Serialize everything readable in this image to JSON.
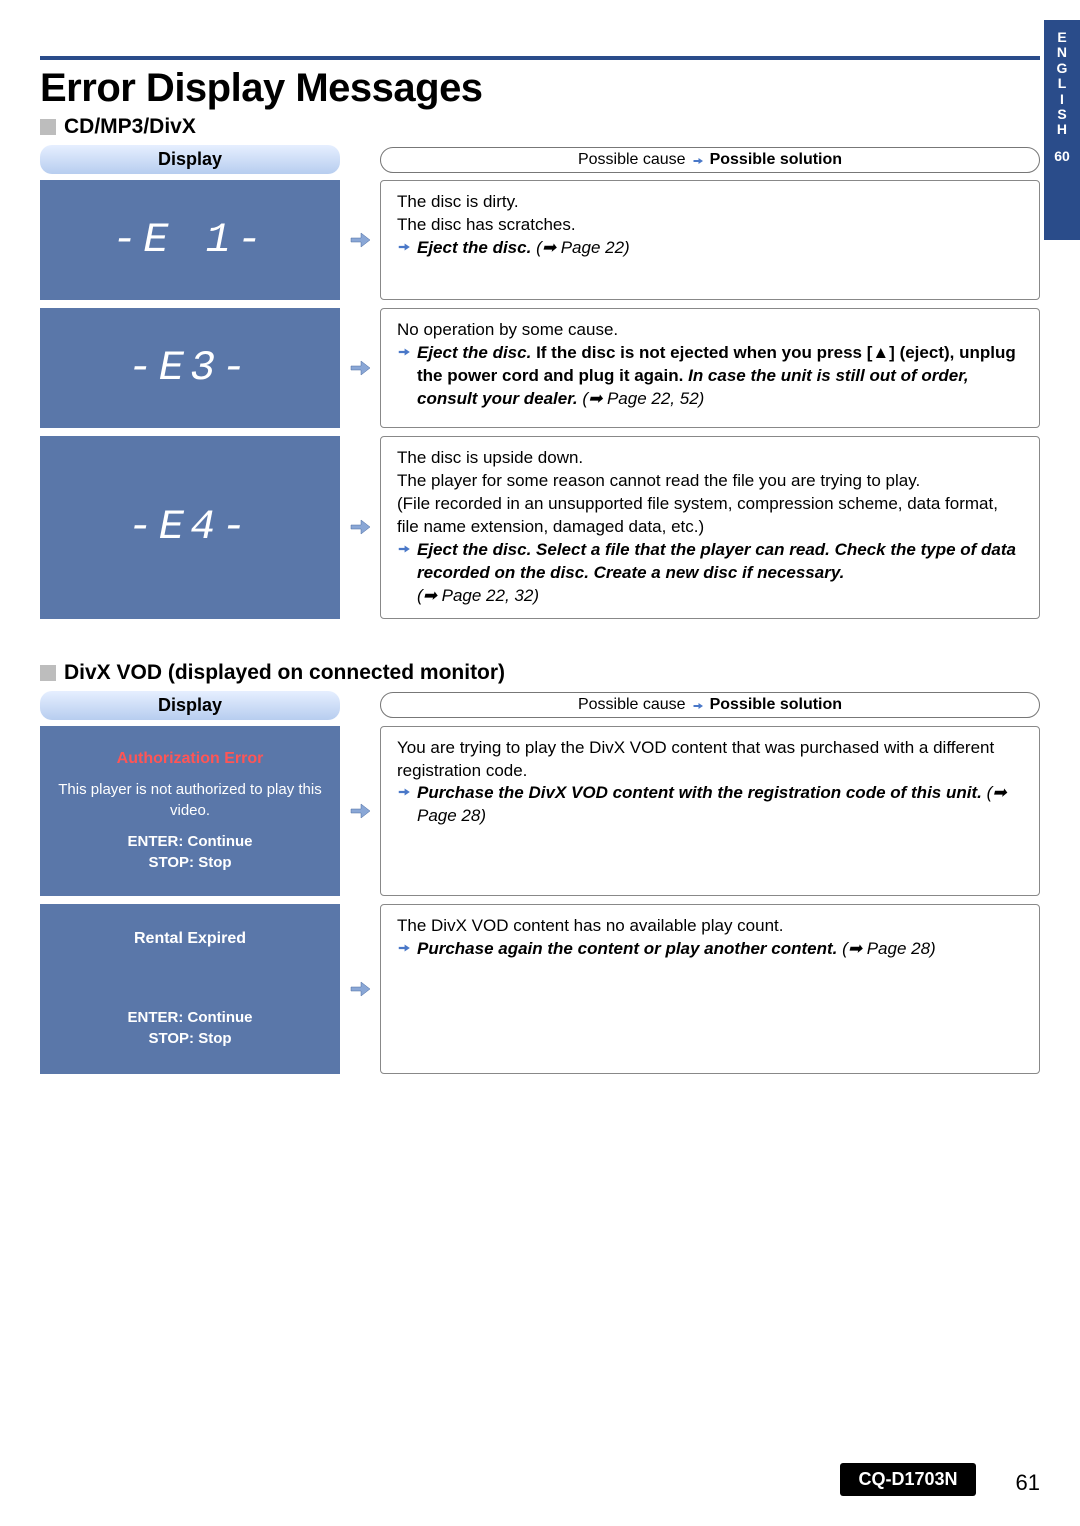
{
  "sideTab": {
    "letters": [
      "E",
      "N",
      "G",
      "L",
      "I",
      "S",
      "H"
    ],
    "num": "60"
  },
  "mainTitle": "Error Display Messages",
  "section1": {
    "heading": "CD/MP3/DivX",
    "displayHeader": "Display",
    "possibleCause": "Possible cause",
    "possibleSolution": "Possible solution",
    "rows": [
      {
        "code": "-E 1-",
        "cause": {
          "l1": "The disc is dirty.",
          "l2": "The disc has scratches.",
          "action": "Eject the disc.",
          "ref": "(➡ Page 22)"
        }
      },
      {
        "code": "-E3-",
        "cause": {
          "l1": "No operation by some cause.",
          "action1": "Eject the disc.",
          "bold1": "If the disc is not ejected when you press [▲] (eject), unplug the power cord and plug it again.",
          "italic1": "In case the unit is still out of order, consult your dealer.",
          "ref": "(➡ Page 22, 52)"
        }
      },
      {
        "code": "-E4-",
        "cause": {
          "l1": "The disc is upside down.",
          "l2": "The player for some reason cannot read the file you are trying to play.",
          "l3": "(File recorded in an unsupported file system, compression scheme, data format, file name extension, damaged data, etc.)",
          "action": "Eject the disc. Select a file that the player can read. Check the type of data recorded on the disc. Create a new disc if necessary.",
          "ref": "(➡ Page 22, 32)"
        }
      }
    ]
  },
  "section2": {
    "heading": "DivX VOD (displayed on connected monitor)",
    "displayHeader": "Display",
    "possibleCause": "Possible cause",
    "possibleSolution": "Possible solution",
    "rows": [
      {
        "display": {
          "title": "Authorization Error",
          "sub": "This player is not authorized to play this video.",
          "enter": "ENTER: Continue",
          "stop": "STOP:   Stop"
        },
        "cause": {
          "l1": "You are trying to play the DivX VOD content that was purchased with a different registration code.",
          "action": "Purchase the DivX VOD content with the registration code of this unit.",
          "ref": "(➡ Page 28)"
        }
      },
      {
        "display": {
          "title": "Rental Expired",
          "enter": "ENTER: Continue",
          "stop": "STOP:   Stop"
        },
        "cause": {
          "l1": "The DivX VOD content has no available play count.",
          "action": "Purchase again the content or play another content.",
          "ref": "(➡ Page 28)"
        }
      }
    ]
  },
  "footer": {
    "model": "CQ-D1703N",
    "pageNum": "61"
  }
}
